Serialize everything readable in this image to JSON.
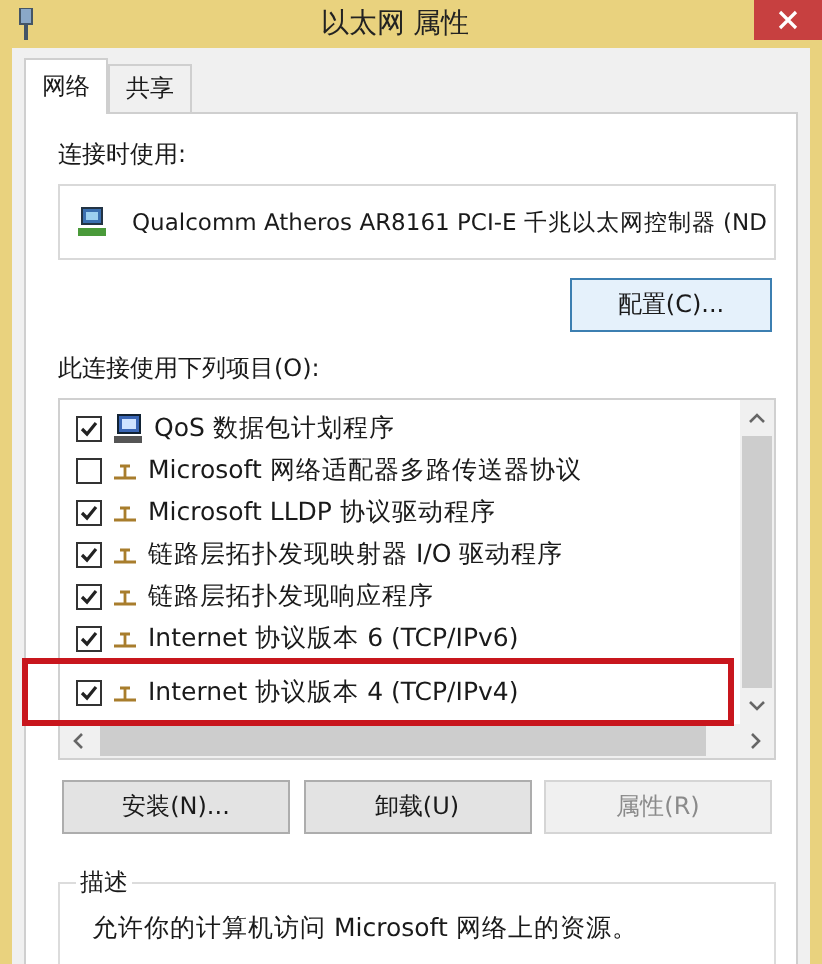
{
  "window": {
    "title": "以太网 属性"
  },
  "tabs": [
    {
      "label": "网络",
      "selected": true
    },
    {
      "label": "共享",
      "selected": false
    }
  ],
  "connect_using": {
    "label": "连接时使用:",
    "adapter": "Qualcomm Atheros AR8161 PCI-E 千兆以太网控制器 (ND",
    "button": "配置(C)..."
  },
  "items_label": "此连接使用下列项目(O):",
  "items": [
    {
      "kind": "service",
      "label": "QoS 数据包计划程序",
      "checked": true,
      "highlighted": false
    },
    {
      "kind": "protocol",
      "label": "Microsoft 网络适配器多路传送器协议",
      "checked": false,
      "highlighted": false
    },
    {
      "kind": "protocol",
      "label": "Microsoft LLDP 协议驱动程序",
      "checked": true,
      "highlighted": false
    },
    {
      "kind": "protocol",
      "label": "链路层拓扑发现映射器 I/O 驱动程序",
      "checked": true,
      "highlighted": false
    },
    {
      "kind": "protocol",
      "label": "链路层拓扑发现响应程序",
      "checked": true,
      "highlighted": false
    },
    {
      "kind": "protocol",
      "label": "Internet 协议版本 6 (TCP/IPv6)",
      "checked": true,
      "highlighted": false
    },
    {
      "kind": "protocol",
      "label": "Internet 协议版本 4 (TCP/IPv4)",
      "checked": true,
      "highlighted": true
    }
  ],
  "buttons": [
    {
      "label": "安装(N)...",
      "disabled": false
    },
    {
      "label": "卸载(U)",
      "disabled": false
    },
    {
      "label": "属性(R)",
      "disabled": true
    }
  ],
  "description": {
    "title": "描述",
    "text": "允许你的计算机访问 Microsoft 网络上的资源。"
  }
}
